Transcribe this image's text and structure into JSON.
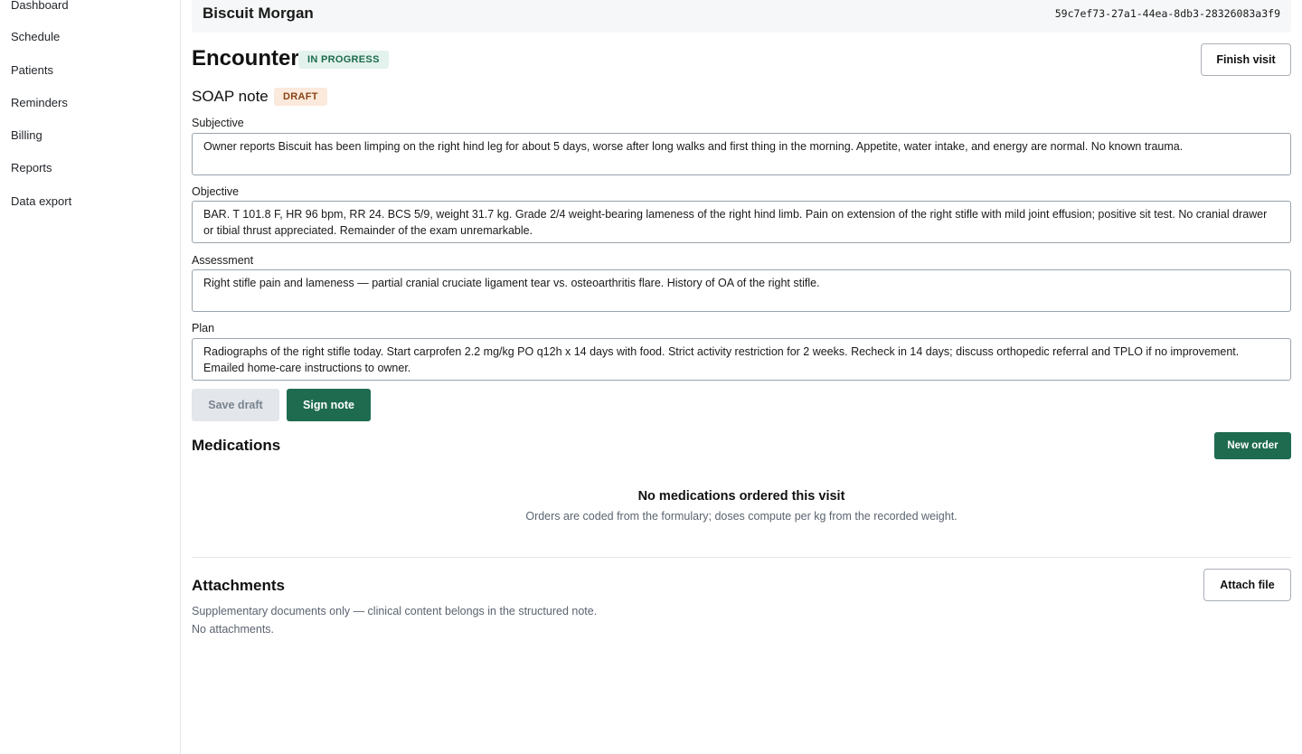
{
  "sidebar": {
    "items": [
      {
        "label": "Dashboard"
      },
      {
        "label": "Schedule"
      },
      {
        "label": "Patients"
      },
      {
        "label": "Reminders"
      },
      {
        "label": "Billing"
      },
      {
        "label": "Reports"
      },
      {
        "label": "Data export"
      }
    ]
  },
  "patient": {
    "name": "Biscuit Morgan",
    "id": "59c7ef73-27a1-44ea-8db3-28326083a3f9"
  },
  "encounter": {
    "title": "Encounter",
    "status": "IN PROGRESS",
    "finish_label": "Finish visit"
  },
  "soap": {
    "title": "SOAP note",
    "status": "DRAFT",
    "subjective_label": "Subjective",
    "subjective": "Owner reports Biscuit has been limping on the right hind leg for about 5 days, worse after long walks and first thing in the morning. Appetite, water intake, and energy are normal. No known trauma.",
    "objective_label": "Objective",
    "objective": "BAR. T 101.8 F, HR 96 bpm, RR 24. BCS 5/9, weight 31.7 kg. Grade 2/4 weight-bearing lameness of the right hind limb. Pain on extension of the right stifle with mild joint effusion; positive sit test. No cranial drawer or tibial thrust appreciated. Remainder of the exam unremarkable.",
    "assessment_label": "Assessment",
    "assessment": "Right stifle pain and lameness — partial cranial cruciate ligament tear vs. osteoarthritis flare. History of OA of the right stifle.",
    "plan_label": "Plan",
    "plan": "Radiographs of the right stifle today. Start carprofen 2.2 mg/kg PO q12h x 14 days with food. Strict activity restriction for 2 weeks. Recheck in 14 days; discuss orthopedic referral and TPLO if no improvement. Emailed home-care instructions to owner.",
    "save_label": "Save draft",
    "sign_label": "Sign note"
  },
  "medications": {
    "title": "Medications",
    "new_order_label": "New order",
    "empty_title": "No medications ordered this visit",
    "empty_sub": "Orders are coded from the formulary; doses compute per kg from the recorded weight."
  },
  "attachments": {
    "title": "Attachments",
    "attach_label": "Attach file",
    "note": "Supplementary documents only — clinical content belongs in the structured note.",
    "empty": "No attachments."
  },
  "colors": {
    "primary": "#1f6b50",
    "in_progress_bg": "#e3f2ec",
    "draft_bg": "#fbe9dc"
  }
}
